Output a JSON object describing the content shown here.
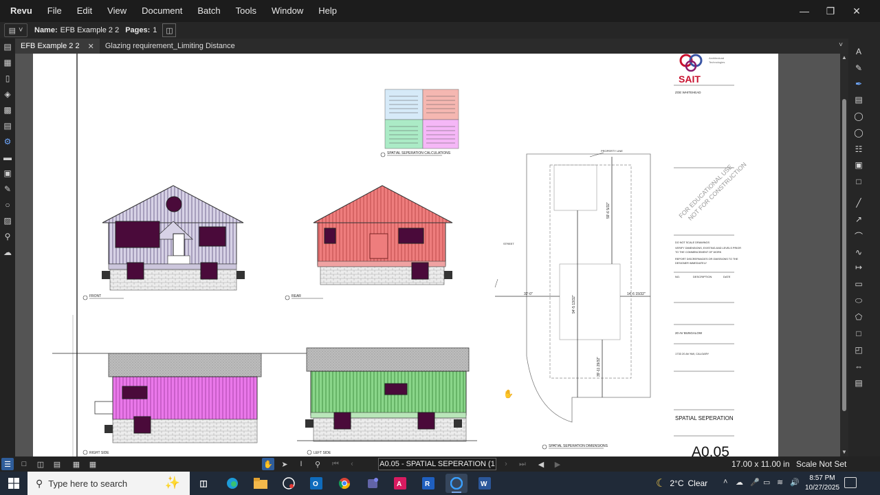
{
  "menubar": {
    "items": [
      "Revu",
      "File",
      "Edit",
      "View",
      "Document",
      "Batch",
      "Tools",
      "Window",
      "Help"
    ],
    "window_controls": [
      "minimize",
      "restore",
      "close"
    ]
  },
  "docbar": {
    "name_label": "Name:",
    "name_value": "EFB Example 2 2",
    "pages_label": "Pages:",
    "pages_value": "1"
  },
  "tabs": [
    {
      "label": "EFB Example 2 2",
      "active": true,
      "closable": true
    },
    {
      "label": "Glazing requirement_Limiting Distance",
      "active": false,
      "closable": false
    }
  ],
  "drawing": {
    "logo_text": "SAIT",
    "logo_subtitle_1": "Architectural",
    "logo_subtitle_2": "Technologies",
    "client": "ZOE WHITEHEAD",
    "watermark_1": "FOR EDUCATIONAL USE",
    "watermark_2": "NOT FOR CONSTRUCTION",
    "notes": [
      "DO NOT SCALE DRAWINGS",
      "VERIFY DIMENSIONS, EXISTING AND LEVELS PRIOR",
      "TO THE COMMENCEMENT OF WORK",
      "REPORT DISCREPANCIES OR OMISSIONS TO THE",
      "DESIGNER IMMEDIATELY"
    ],
    "rev_headers": [
      "NO.",
      "DESCRIPTION",
      "DATE"
    ],
    "project": "20 AV BUNGALOW",
    "address": "1733 20 AV NW, CALGARY",
    "sheet_title": "SPATIAL SEPERATION",
    "sheet_number": "A0.05",
    "elevation_labels": [
      "FRONT",
      "REAR",
      "RIGHT SIDE",
      "LEFT SIDE"
    ],
    "calc_title": "SPATIAL SEPERATION CALCULATIONS",
    "calc_boxes": [
      {
        "title": "FRONT WALL",
        "color": "#d6eaf8"
      },
      {
        "title": "REAR WALL",
        "color": "#f5b7b1"
      },
      {
        "title": "LEFT WALL",
        "color": "#abebc6"
      },
      {
        "title": "RIGHT WALL",
        "color": "#f5b7f7"
      }
    ],
    "site_plan_title": "SPATIAL SEPERATION DIMENSIONS",
    "site_dims": [
      "32'-0\"",
      "14'-6 15/32\"",
      "59'-6 5/32\"",
      "94'-5 13/32\"",
      "39'-11 29/32\""
    ],
    "street_label": "STREET",
    "property_label": "PROPERTY LINE"
  },
  "statusbar": {
    "page_label": "A0.05 - SPATIAL SEPERATION (1 of 1)",
    "dimensions": "17.00 x 11.00 in",
    "scale": "Scale Not Set"
  },
  "taskbar": {
    "search_placeholder": "Type here to search",
    "apps": [
      "task-view",
      "edge",
      "file-explorer",
      "media-app",
      "outlook",
      "chrome",
      "teams",
      "acrobat",
      "revit",
      "revu",
      "word"
    ],
    "weather_temp": "2°C",
    "weather_text": "Clear",
    "time": "8:57 PM",
    "date": "10/27/2025"
  },
  "colors": {
    "front_elev": "#b8b0d0",
    "rear_elev": "#e86e6e",
    "right_elev": "#e86ce8",
    "left_elev": "#7ed07e",
    "window": "#4a0a3a",
    "accent": "#2f5d9a"
  }
}
